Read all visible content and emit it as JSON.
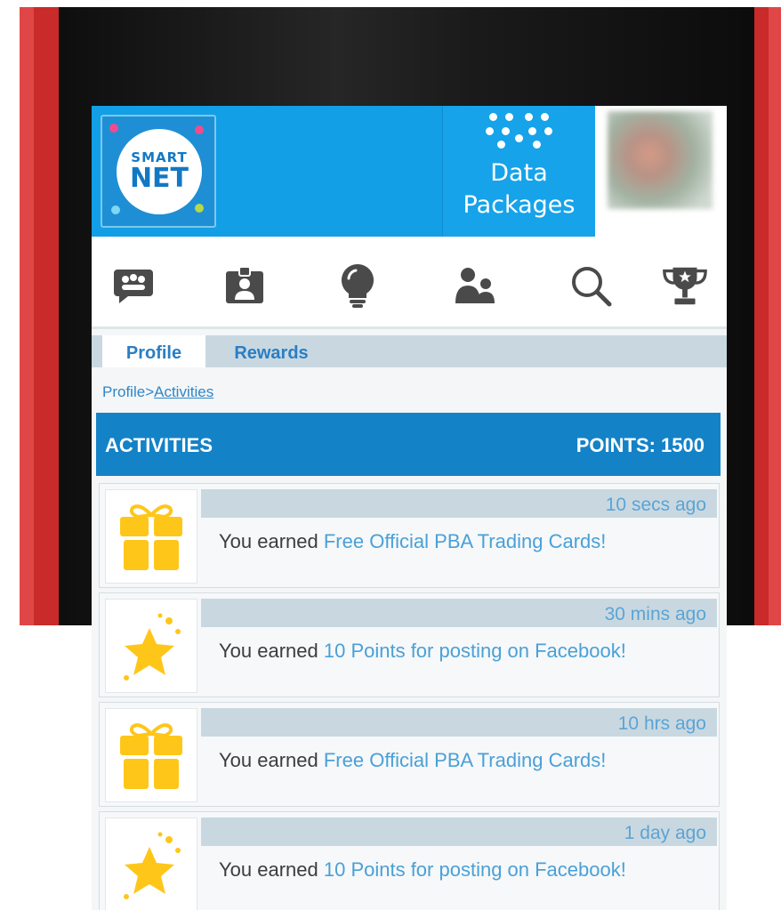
{
  "header": {
    "logo": {
      "line1": "SMART",
      "line2": "NET"
    },
    "data_packages_label": "Data Packages"
  },
  "nav_icons": [
    {
      "icon": "chat-bubble-icon"
    },
    {
      "icon": "id-badge-icon"
    },
    {
      "icon": "lightbulb-icon"
    },
    {
      "icon": "people-icon"
    },
    {
      "icon": "search-icon"
    },
    {
      "icon": "trophy-icon"
    }
  ],
  "tabs": [
    {
      "label": "Profile",
      "active": true
    },
    {
      "label": "Rewards",
      "active": false
    }
  ],
  "breadcrumb": {
    "root": "Profile",
    "separator": ">",
    "current": "Activities"
  },
  "activities": {
    "title": "ACTIVITIES",
    "points_label": "POINTS: 1500",
    "items": [
      {
        "icon": "gift-icon",
        "time": "10 secs ago",
        "prefix": "You earned ",
        "reward": "Free Official PBA Trading Cards!"
      },
      {
        "icon": "star-icon",
        "time": "30 mins ago",
        "prefix": "You earned ",
        "reward": "10 Points for posting on Facebook!"
      },
      {
        "icon": "gift-icon",
        "time": "10 hrs ago",
        "prefix": "You earned ",
        "reward": "Free Official PBA Trading Cards!"
      },
      {
        "icon": "star-icon",
        "time": "1 day ago",
        "prefix": "You earned ",
        "reward": "10 Points for posting on Facebook!"
      }
    ]
  },
  "colors": {
    "banner": "#139fe6",
    "header_bar": "#1482c7",
    "link": "#4aa0d8",
    "icon_gray": "#4a4a4a",
    "reward_yellow": "#ffc61a",
    "phone_red": "#c92a2a"
  }
}
